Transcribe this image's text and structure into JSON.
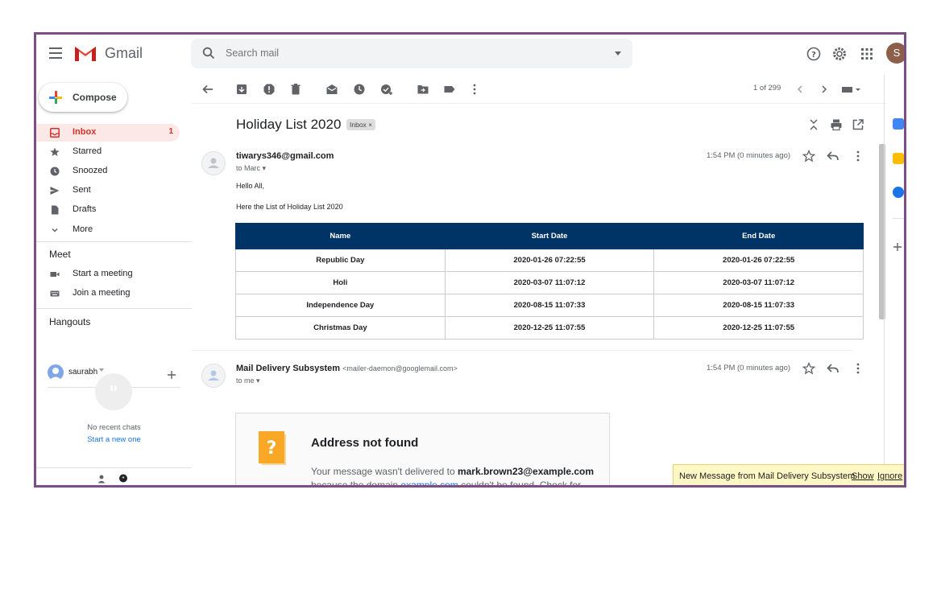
{
  "app": {
    "name": "Gmail"
  },
  "search": {
    "placeholder": "Search mail"
  },
  "account": {
    "initial": "S"
  },
  "sidebar": {
    "compose_label": "Compose",
    "items": [
      {
        "label": "Inbox",
        "count": "1"
      },
      {
        "label": "Starred"
      },
      {
        "label": "Snoozed"
      },
      {
        "label": "Sent"
      },
      {
        "label": "Drafts"
      },
      {
        "label": "More"
      }
    ],
    "meet": {
      "title": "Meet",
      "items": [
        {
          "label": "Start a meeting"
        },
        {
          "label": "Join a meeting"
        }
      ]
    },
    "hangouts": {
      "title": "Hangouts",
      "user": "saurabh",
      "no_chats": "No recent chats",
      "start_new": "Start a new one"
    }
  },
  "toolbar": {
    "pager": "1 of 299"
  },
  "thread": {
    "subject": "Holiday List 2020",
    "label": "Inbox",
    "messages": [
      {
        "sender": "tiwarys346@gmail.com",
        "to": "to Marc",
        "time": "1:54 PM (0 minutes ago)",
        "greeting": "Hello All,",
        "intro": "Here the List of Holiday List 2020",
        "table": {
          "headers": [
            "Name",
            "Start Date",
            "End Date"
          ],
          "rows": [
            [
              "Republic Day",
              "2020-01-26 07:22:55",
              "2020-01-26 07:22:55"
            ],
            [
              "Holi",
              "2020-03-07 11:07:12",
              "2020-03-07 11:07:12"
            ],
            [
              "Independence Day",
              "2020-08-15 11:07:33",
              "2020-08-15 11:07:33"
            ],
            [
              "Christmas Day",
              "2020-12-25 11:07:55",
              "2020-12-25 11:07:55"
            ]
          ]
        }
      },
      {
        "sender": "Mail Delivery Subsystem",
        "sender_email": "<mailer-daemon@googlemail.com>",
        "to": "to me",
        "time": "1:54 PM (0 minutes ago)",
        "bounce": {
          "title": "Address not found",
          "text_before": "Your message wasn't delivered to ",
          "recipient": "mark.brown23@example.com",
          "text_line2a": "because the domain ",
          "domain_link": "example.com",
          "text_line2b": " couldn't be found. Check for"
        }
      }
    ]
  },
  "notification": {
    "text": "New Message from Mail Delivery Subsystem",
    "show": "Show",
    "ignore": "Ignore"
  },
  "colors": {
    "accent_red": "#d93025",
    "table_header": "#003366",
    "frame_border": "#7b4f83"
  }
}
